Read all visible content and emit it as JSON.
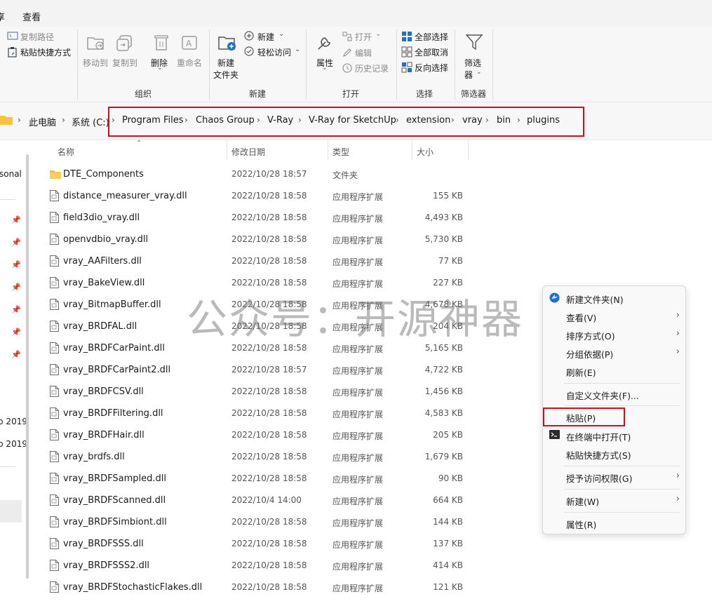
{
  "menubar": {
    "left_fragment": "享",
    "view_label": "查看"
  },
  "ribbon": {
    "clipboard": {
      "copy_path": "复制路径",
      "paste_shortcut": "粘贴快捷方式"
    },
    "organize": {
      "move_to": "移动到",
      "copy_to": "复制到",
      "delete": "删除",
      "rename": "重命名",
      "group_label": "组织"
    },
    "new": {
      "new_folder_line1": "新建",
      "new_folder_line2": "文件夹",
      "new_item": "新建",
      "easy_access": "轻松访问",
      "group_label": "新建"
    },
    "open": {
      "properties": "属性",
      "open": "打开",
      "edit": "编辑",
      "history": "历史记录",
      "group_label": "打开"
    },
    "select": {
      "select_all": "全部选择",
      "select_none": "全部取消",
      "invert": "反向选择",
      "group_label": "选择"
    },
    "filter": {
      "filter_line1": "筛选",
      "filter_line2": "器",
      "group_label": "筛选器"
    }
  },
  "breadcrumb": [
    "此电脑",
    "系统 (C:)",
    "Program Files",
    "Chaos Group",
    "V-Ray",
    "V-Ray for SketchUp",
    "extension",
    "vray",
    "bin",
    "plugins"
  ],
  "navpane": {
    "personal_fragment": "sonal",
    "item_a": "p 2019",
    "item_b": "p 2019"
  },
  "columns": {
    "name": "名称",
    "date": "修改日期",
    "type": "类型",
    "size": "大小"
  },
  "files": [
    {
      "name": "DTE_Components",
      "date": "2022/10/28 18:57",
      "type": "文件夹",
      "size": "",
      "kind": "folder"
    },
    {
      "name": "distance_measurer_vray.dll",
      "date": "2022/10/28 18:58",
      "type": "应用程序扩展",
      "size": "155 KB",
      "kind": "file"
    },
    {
      "name": "field3dio_vray.dll",
      "date": "2022/10/28 18:58",
      "type": "应用程序扩展",
      "size": "4,493 KB",
      "kind": "file"
    },
    {
      "name": "openvdbio_vray.dll",
      "date": "2022/10/28 18:58",
      "type": "应用程序扩展",
      "size": "5,730 KB",
      "kind": "file"
    },
    {
      "name": "vray_AAFilters.dll",
      "date": "2022/10/28 18:58",
      "type": "应用程序扩展",
      "size": "77 KB",
      "kind": "file"
    },
    {
      "name": "vray_BakeView.dll",
      "date": "2022/10/28 18:58",
      "type": "应用程序扩展",
      "size": "227 KB",
      "kind": "file"
    },
    {
      "name": "vray_BitmapBuffer.dll",
      "date": "2022/10/28 18:58",
      "type": "应用程序扩展",
      "size": "4,678 KB",
      "kind": "file"
    },
    {
      "name": "vray_BRDFAL.dll",
      "date": "2022/10/28 18:58",
      "type": "应用程序扩展",
      "size": "204 KB",
      "kind": "file"
    },
    {
      "name": "vray_BRDFCarPaint.dll",
      "date": "2022/10/28 18:58",
      "type": "应用程序扩展",
      "size": "5,165 KB",
      "kind": "file"
    },
    {
      "name": "vray_BRDFCarPaint2.dll",
      "date": "2022/10/28 18:57",
      "type": "应用程序扩展",
      "size": "4,722 KB",
      "kind": "file"
    },
    {
      "name": "vray_BRDFCSV.dll",
      "date": "2022/10/28 18:58",
      "type": "应用程序扩展",
      "size": "1,456 KB",
      "kind": "file"
    },
    {
      "name": "vray_BRDFFiltering.dll",
      "date": "2022/10/28 18:58",
      "type": "应用程序扩展",
      "size": "4,583 KB",
      "kind": "file"
    },
    {
      "name": "vray_BRDFHair.dll",
      "date": "2022/10/28 18:58",
      "type": "应用程序扩展",
      "size": "205 KB",
      "kind": "file"
    },
    {
      "name": "vray_brdfs.dll",
      "date": "2022/10/28 18:58",
      "type": "应用程序扩展",
      "size": "1,679 KB",
      "kind": "file"
    },
    {
      "name": "vray_BRDFSampled.dll",
      "date": "2022/10/28 18:58",
      "type": "应用程序扩展",
      "size": "90 KB",
      "kind": "file"
    },
    {
      "name": "vray_BRDFScanned.dll",
      "date": "2022/10/4 14:00",
      "type": "应用程序扩展",
      "size": "664 KB",
      "kind": "file"
    },
    {
      "name": "vray_BRDFSimbiont.dll",
      "date": "2022/10/28 18:58",
      "type": "应用程序扩展",
      "size": "144 KB",
      "kind": "file"
    },
    {
      "name": "vray_BRDFSSS.dll",
      "date": "2022/10/28 18:58",
      "type": "应用程序扩展",
      "size": "137 KB",
      "kind": "file"
    },
    {
      "name": "vray_BRDFSSS2.dll",
      "date": "2022/10/28 18:58",
      "type": "应用程序扩展",
      "size": "414 KB",
      "kind": "file"
    },
    {
      "name": "vray_BRDFStochasticFlakes.dll",
      "date": "2022/10/28 18:58",
      "type": "应用程序扩展",
      "size": "121 KB",
      "kind": "file"
    }
  ],
  "watermark": "公众号：开源神器",
  "context_menu": {
    "new_folder": "新建文件夹(N)",
    "view": "查看(V)",
    "sort_by": "排序方式(O)",
    "group_by": "分组依据(P)",
    "refresh": "刷新(E)",
    "customize": "自定义文件夹(F)...",
    "paste": "粘贴(P)",
    "open_terminal": "在终端中打开(T)",
    "paste_shortcut": "粘贴快捷方式(S)",
    "grant_access": "授予访问权限(G)",
    "new": "新建(W)",
    "properties": "属性(R)"
  },
  "colors": {
    "highlight_red": "#c8101e",
    "accent_blue": "#1f6fcf",
    "folder_yellow": "#f5c242"
  }
}
